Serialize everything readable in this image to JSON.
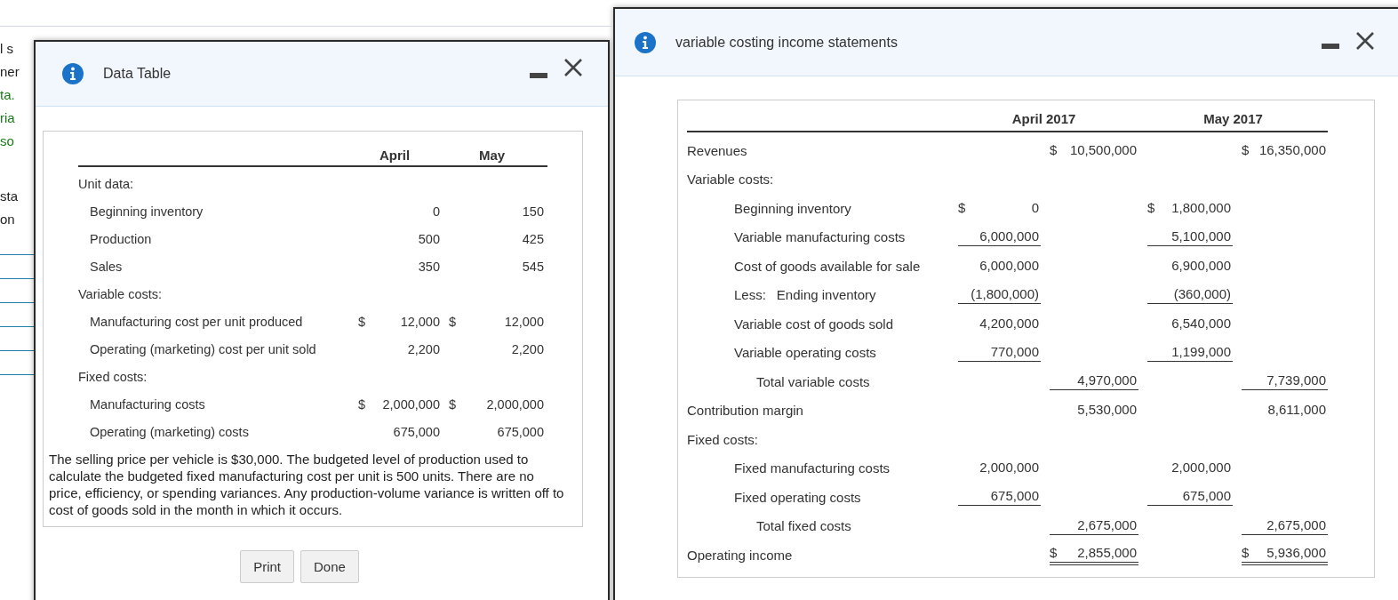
{
  "background_fragments": [
    {
      "text": "l s",
      "kind": "plain"
    },
    {
      "text": "ner",
      "kind": "plain"
    },
    {
      "text": "ta.",
      "kind": "link"
    },
    {
      "text": "ria",
      "kind": "link"
    },
    {
      "text": "so",
      "kind": "link"
    },
    {
      "text": "sta",
      "kind": "plain"
    },
    {
      "text": "on",
      "kind": "plain"
    }
  ],
  "data_table_window": {
    "title": "Data Table",
    "columns": [
      "April",
      "May"
    ],
    "rows": [
      {
        "kind": "section",
        "label": "Unit data:"
      },
      {
        "kind": "item",
        "label": "Beginning inventory",
        "cells": [
          {
            "value": "0"
          },
          {
            "value": "150"
          }
        ]
      },
      {
        "kind": "item",
        "label": "Production",
        "cells": [
          {
            "value": "500"
          },
          {
            "value": "425"
          }
        ]
      },
      {
        "kind": "item",
        "label": "Sales",
        "cells": [
          {
            "value": "350"
          },
          {
            "value": "545"
          }
        ]
      },
      {
        "kind": "section",
        "label": "Variable costs:"
      },
      {
        "kind": "item",
        "label": "Manufacturing cost per unit produced",
        "cells": [
          {
            "currency": "$",
            "value": "12,000"
          },
          {
            "currency": "$",
            "value": "12,000"
          }
        ]
      },
      {
        "kind": "item",
        "label": "Operating (marketing) cost per unit sold",
        "cells": [
          {
            "value": "2,200"
          },
          {
            "value": "2,200"
          }
        ]
      },
      {
        "kind": "section",
        "label": "Fixed costs:"
      },
      {
        "kind": "item",
        "label": "Manufacturing costs",
        "cells": [
          {
            "currency": "$",
            "value": "2,000,000"
          },
          {
            "currency": "$",
            "value": "2,000,000"
          }
        ]
      },
      {
        "kind": "item",
        "label": "Operating (marketing) costs",
        "cells": [
          {
            "value": "675,000"
          },
          {
            "value": "675,000"
          }
        ]
      }
    ],
    "note": "The selling price per vehicle is $30,000. The budgeted level of production used to calculate the budgeted fixed manufacturing cost per unit is 500 units. There are no price, efficiency, or spending variances. Any production-volume variance is written off to cost of goods sold in the month in which it occurs.",
    "buttons": [
      "Print",
      "Done"
    ]
  },
  "statement_window": {
    "title": "variable costing income statements",
    "columns": [
      "April 2017",
      "May 2017"
    ],
    "rows": [
      {
        "kind": "line",
        "label": "Revenues",
        "cells": [
          null,
          {
            "currency": "$",
            "value": "10,500,000"
          },
          null,
          {
            "currency": "$",
            "value": "16,350,000"
          }
        ]
      },
      {
        "kind": "section",
        "label": "Variable costs:"
      },
      {
        "kind": "item",
        "label": "Beginning inventory",
        "cells": [
          {
            "currency": "$",
            "value": "0"
          },
          null,
          {
            "currency": "$",
            "value": "1,800,000"
          },
          null
        ]
      },
      {
        "kind": "item",
        "label": "Variable manufacturing costs",
        "cells": [
          {
            "value": "6,000,000",
            "underline": true
          },
          null,
          {
            "value": "5,100,000",
            "underline": true
          },
          null
        ]
      },
      {
        "kind": "item",
        "label": "Cost of goods available for sale",
        "cells": [
          {
            "value": "6,000,000"
          },
          null,
          {
            "value": "6,900,000"
          },
          null
        ]
      },
      {
        "kind": "item",
        "prefix": "Less:",
        "label": "Ending inventory",
        "cells": [
          {
            "value": "(1,800,000)",
            "underline": true
          },
          null,
          {
            "value": "(360,000)",
            "underline": true
          },
          null
        ]
      },
      {
        "kind": "item",
        "label": "Variable cost of goods sold",
        "cells": [
          {
            "value": "4,200,000"
          },
          null,
          {
            "value": "6,540,000"
          },
          null
        ]
      },
      {
        "kind": "item",
        "label": "Variable operating costs",
        "cells": [
          {
            "value": "770,000",
            "underline": true
          },
          null,
          {
            "value": "1,199,000",
            "underline": true
          },
          null
        ]
      },
      {
        "kind": "total",
        "label": "Total variable costs",
        "cells": [
          null,
          {
            "value": "4,970,000",
            "underline": true
          },
          null,
          {
            "value": "7,739,000",
            "underline": true
          }
        ]
      },
      {
        "kind": "line",
        "label": "Contribution margin",
        "cells": [
          null,
          {
            "value": "5,530,000"
          },
          null,
          {
            "value": "8,611,000"
          }
        ]
      },
      {
        "kind": "section",
        "label": "Fixed costs:"
      },
      {
        "kind": "item",
        "label": "Fixed manufacturing costs",
        "cells": [
          {
            "value": "2,000,000"
          },
          null,
          {
            "value": "2,000,000"
          },
          null
        ]
      },
      {
        "kind": "item",
        "label": "Fixed operating costs",
        "cells": [
          {
            "value": "675,000",
            "underline": true
          },
          null,
          {
            "value": "675,000",
            "underline": true
          },
          null
        ]
      },
      {
        "kind": "total",
        "label": "Total fixed costs",
        "cells": [
          null,
          {
            "value": "2,675,000",
            "underline": true
          },
          null,
          {
            "value": "2,675,000",
            "underline": true
          }
        ]
      },
      {
        "kind": "line",
        "label": "Operating income",
        "cells": [
          null,
          {
            "currency": "$",
            "value": "2,855,000",
            "double_underline": true
          },
          null,
          {
            "currency": "$",
            "value": "5,936,000",
            "double_underline": true
          }
        ]
      }
    ]
  }
}
